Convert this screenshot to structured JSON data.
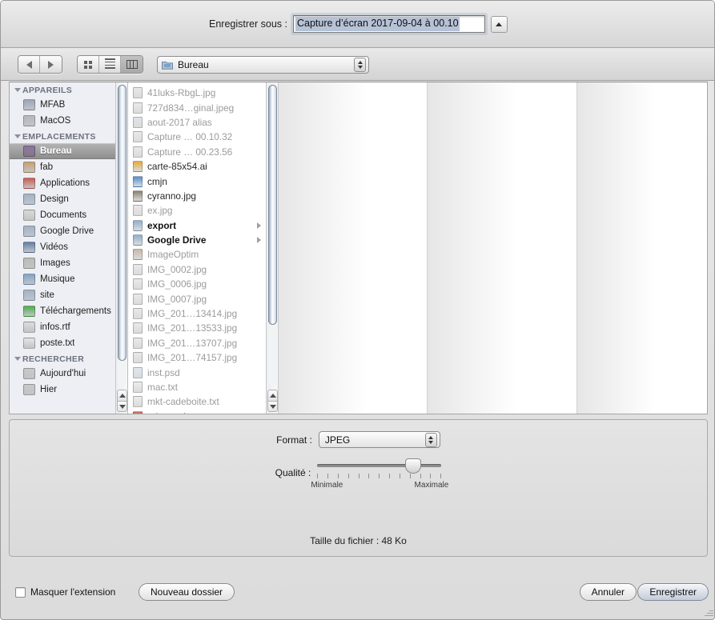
{
  "titlebar": {
    "save_as_label": "Enregistrer sous :",
    "filename_value": "Capture d’écran 2017-09-04 à 00.10",
    "expand_icon": "triangle-up-icon"
  },
  "toolbar": {
    "back_icon": "arrow-left-icon",
    "forward_icon": "arrow-right-icon",
    "view_icon_grid": "icon-view-icon",
    "view_icon_list": "list-view-icon",
    "view_icon_column": "column-view-icon",
    "active_view": "column",
    "path_label": "Bureau",
    "path_icon": "folder-icon",
    "search_placeholder": "",
    "search_value": "",
    "search_icon": "search-icon"
  },
  "sidebar": {
    "groups": [
      {
        "title": "APPAREILS",
        "items": [
          {
            "label": "MFAB",
            "icon": "display-icon",
            "color": "#9aa6b8",
            "selected": false
          },
          {
            "label": "MacOS",
            "icon": "harddisk-icon",
            "color": "#b3b8bf",
            "selected": false
          }
        ]
      },
      {
        "title": "EMPLACEMENTS",
        "items": [
          {
            "label": "Bureau",
            "icon": "desktop-icon",
            "color": "#8f6ea8",
            "selected": true
          },
          {
            "label": "fab",
            "icon": "home-icon",
            "color": "#c9a06a",
            "selected": false
          },
          {
            "label": "Applications",
            "icon": "applications-icon",
            "color": "#d0594a",
            "selected": false
          },
          {
            "label": "Design",
            "icon": "folder-icon",
            "color": "#9fb3c9",
            "selected": false
          },
          {
            "label": "Documents",
            "icon": "documents-folder-icon",
            "color": "#d9d9d2",
            "selected": false
          },
          {
            "label": "Google Drive",
            "icon": "google-drive-folder-icon",
            "color": "#9fb3c9",
            "selected": false
          },
          {
            "label": "Vidéos",
            "icon": "movies-folder-icon",
            "color": "#5d7fa8",
            "selected": false
          },
          {
            "label": "Images",
            "icon": "pictures-folder-icon",
            "color": "#b9bcb4",
            "selected": false
          },
          {
            "label": "Musique",
            "icon": "music-folder-icon",
            "color": "#7fa4cc",
            "selected": false
          },
          {
            "label": "site",
            "icon": "folder-icon",
            "color": "#9fb3c9",
            "selected": false
          },
          {
            "label": "Téléchargements",
            "icon": "downloads-icon",
            "color": "#49b24a",
            "selected": false
          },
          {
            "label": "infos.rtf",
            "icon": "rtf-document-icon",
            "color": "#dcdcdc",
            "selected": false
          },
          {
            "label": "poste.txt",
            "icon": "text-document-icon",
            "color": "#e4e4e4",
            "selected": false
          }
        ]
      },
      {
        "title": "RECHERCHER",
        "items": [
          {
            "label": "Aujourd'hui",
            "icon": "clock-icon",
            "color": "#c8c8c8",
            "selected": false
          },
          {
            "label": "Hier",
            "icon": "clock-icon",
            "color": "#c8c8c8",
            "selected": false
          }
        ]
      }
    ]
  },
  "filelist": {
    "items": [
      {
        "name": "41luks-RbgL.jpg",
        "icon": "jpeg-file-icon",
        "color": "#e9e9e9",
        "dimmed": true,
        "folder": false
      },
      {
        "name": "727d834…ginal.jpeg",
        "icon": "jpeg-file-icon",
        "color": "#e9e9e9",
        "dimmed": true,
        "folder": false
      },
      {
        "name": "aout-2017 alias",
        "icon": "alias-file-icon",
        "color": "#dfe4ea",
        "dimmed": true,
        "folder": false
      },
      {
        "name": "Capture … 00.10.32",
        "icon": "jpeg-file-icon",
        "color": "#e9e9e9",
        "dimmed": true,
        "folder": false
      },
      {
        "name": "Capture … 00.23.56",
        "icon": "jpeg-file-icon",
        "color": "#e9e9e9",
        "dimmed": true,
        "folder": false
      },
      {
        "name": "carte-85x54.ai",
        "icon": "illustrator-file-icon",
        "color": "#e8a93c",
        "dimmed": false,
        "folder": false
      },
      {
        "name": "cmjn",
        "icon": "photoshop-droplet-icon",
        "color": "#4f90d6",
        "dimmed": false,
        "folder": false
      },
      {
        "name": "cyranno.jpg",
        "icon": "image-preview-icon",
        "color": "#8a8273",
        "dimmed": false,
        "folder": false
      },
      {
        "name": "ex.jpg",
        "icon": "jpeg-file-icon",
        "color": "#e9e9e9",
        "dimmed": true,
        "folder": false
      },
      {
        "name": "export",
        "icon": "folder-icon",
        "color": "#8fb0cf",
        "dimmed": false,
        "folder": true
      },
      {
        "name": "Google Drive",
        "icon": "google-drive-folder-icon",
        "color": "#8fb0cf",
        "dimmed": false,
        "folder": true
      },
      {
        "name": "ImageOptim",
        "icon": "app-icon",
        "color": "#c7b9a8",
        "dimmed": true,
        "folder": false
      },
      {
        "name": "IMG_0002.jpg",
        "icon": "jpeg-file-icon",
        "color": "#e9e9e9",
        "dimmed": true,
        "folder": false
      },
      {
        "name": "IMG_0006.jpg",
        "icon": "jpeg-file-icon",
        "color": "#e9e9e9",
        "dimmed": true,
        "folder": false
      },
      {
        "name": "IMG_0007.jpg",
        "icon": "jpeg-file-icon",
        "color": "#e9e9e9",
        "dimmed": true,
        "folder": false
      },
      {
        "name": "IMG_201…13414.jpg",
        "icon": "jpeg-file-icon",
        "color": "#e9e9e9",
        "dimmed": true,
        "folder": false
      },
      {
        "name": "IMG_201…13533.jpg",
        "icon": "jpeg-file-icon",
        "color": "#e9e9e9",
        "dimmed": true,
        "folder": false
      },
      {
        "name": "IMG_201…13707.jpg",
        "icon": "jpeg-file-icon",
        "color": "#e9e9e9",
        "dimmed": true,
        "folder": false
      },
      {
        "name": "IMG_201…74157.jpg",
        "icon": "jpeg-file-icon",
        "color": "#e9e9e9",
        "dimmed": true,
        "folder": false
      },
      {
        "name": "inst.psd",
        "icon": "photoshop-file-icon",
        "color": "#dfe7ee",
        "dimmed": true,
        "folder": false
      },
      {
        "name": "mac.txt",
        "icon": "text-document-icon",
        "color": "#ececec",
        "dimmed": true,
        "folder": false
      },
      {
        "name": "mkt-cadeboite.txt",
        "icon": "text-document-icon",
        "color": "#ececec",
        "dimmed": true,
        "folder": false
      },
      {
        "name": "relax.psd",
        "icon": "photoshop-file-icon",
        "color": "#c86a5a",
        "dimmed": false,
        "folder": false
      }
    ]
  },
  "options": {
    "format_label": "Format :",
    "format_value": "JPEG",
    "quality_label": "Qualité :",
    "quality_min_label": "Minimale",
    "quality_max_label": "Maximale",
    "quality_tick_count": 13,
    "quality_percent": 77,
    "filesize_text": "Taille du fichier : 48 Ko"
  },
  "bottombar": {
    "hide_extension_label": "Masquer l'extension",
    "hide_extension_checked": false,
    "new_folder_label": "Nouveau dossier",
    "cancel_label": "Annuler",
    "save_label": "Enregistrer"
  }
}
